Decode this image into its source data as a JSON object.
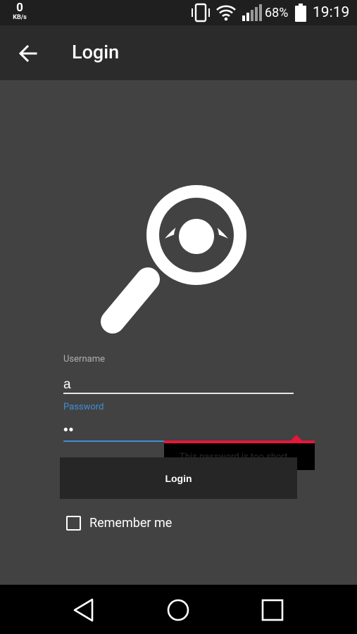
{
  "status_bar": {
    "net_speed_value": "0",
    "net_speed_unit": "KB/s",
    "battery_percent": "68%",
    "time": "19:19"
  },
  "app_bar": {
    "title": "Login"
  },
  "form": {
    "username_label": "Username",
    "username_value": "a",
    "password_label": "Password",
    "password_value": "aa",
    "error_message": "This password is too short",
    "login_button": "Login",
    "remember_me": "Remember me"
  },
  "icons": {
    "back": "arrow-back-icon",
    "logo": "magnifier-eye-icon",
    "vibrate": "vibrate-icon",
    "wifi": "wifi-icon",
    "signal": "signal-icon",
    "battery": "battery-icon",
    "nav_back": "triangle-back-icon",
    "nav_home": "circle-home-icon",
    "nav_recents": "square-recents-icon"
  },
  "colors": {
    "background": "#424242",
    "app_bar": "#2b2b2b",
    "accent": "#3f8fd6",
    "error": "#e8153c"
  }
}
